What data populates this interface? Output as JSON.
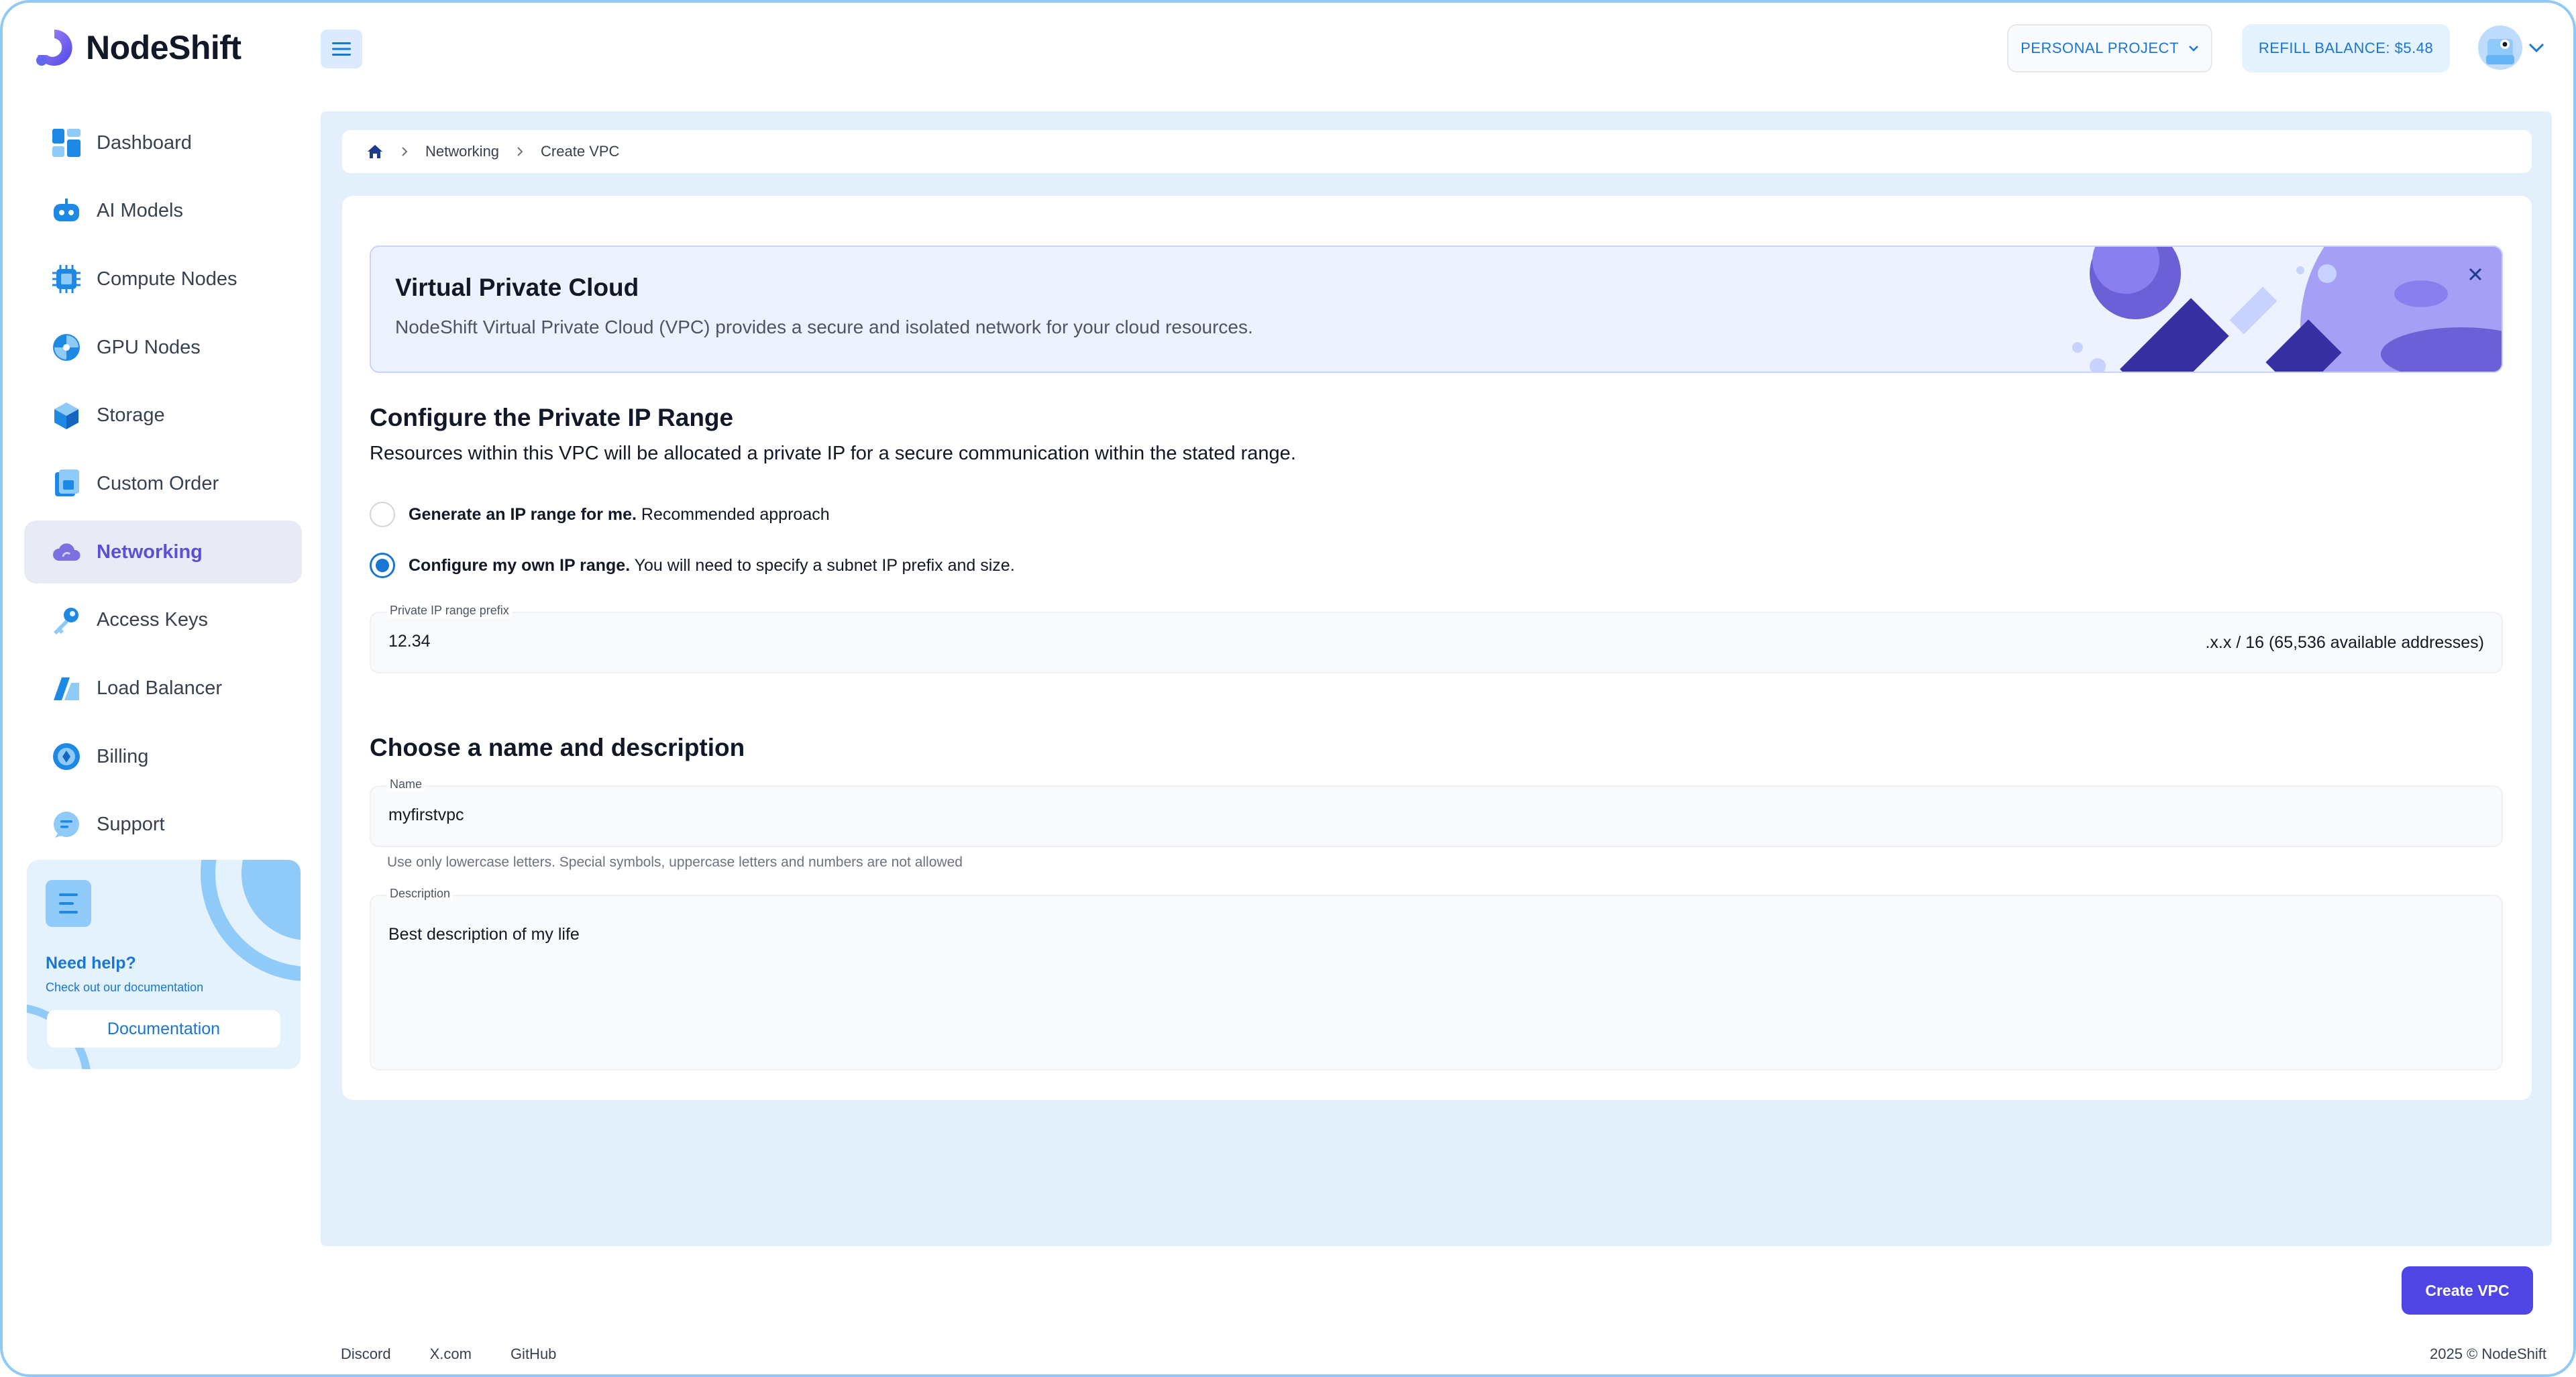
{
  "brand": {
    "name": "NodeShift"
  },
  "header": {
    "project_label": "PERSONAL PROJECT",
    "refill_label": "REFILL BALANCE: $5.48"
  },
  "sidebar": {
    "items": [
      {
        "label": "Dashboard",
        "icon": "dashboard-icon"
      },
      {
        "label": "AI Models",
        "icon": "robot-icon"
      },
      {
        "label": "Compute Nodes",
        "icon": "chip-icon"
      },
      {
        "label": "GPU Nodes",
        "icon": "gpu-icon"
      },
      {
        "label": "Storage",
        "icon": "cube-icon"
      },
      {
        "label": "Custom Order",
        "icon": "order-icon"
      },
      {
        "label": "Networking",
        "icon": "cloud-icon"
      },
      {
        "label": "Access Keys",
        "icon": "key-icon"
      },
      {
        "label": "Load Balancer",
        "icon": "balancer-icon"
      },
      {
        "label": "Billing",
        "icon": "billing-icon"
      },
      {
        "label": "Support",
        "icon": "chat-icon"
      }
    ],
    "active_index": 6,
    "help": {
      "title": "Need help?",
      "subtitle": "Check out our documentation",
      "button": "Documentation"
    }
  },
  "breadcrumb": {
    "items": [
      "Networking",
      "Create VPC"
    ]
  },
  "banner": {
    "title": "Virtual Private Cloud",
    "description": "NodeShift Virtual Private Cloud (VPC) provides a secure and isolated network for your cloud resources."
  },
  "ip_section": {
    "title": "Configure the Private IP Range",
    "description": "Resources within this VPC will be allocated a private IP for a secure communication within the stated range.",
    "option_auto": {
      "bold": "Generate an IP range for me.",
      "rest": " Recommended approach",
      "checked": false
    },
    "option_custom": {
      "bold": "Configure my own IP range.",
      "rest": " You will need to specify a subnet IP prefix and size.",
      "checked": true
    },
    "prefix_field": {
      "label": "Private IP range prefix",
      "value": "12.34",
      "suffix": ".x.x / 16 (65,536 available addresses)"
    }
  },
  "name_section": {
    "title": "Choose a name and description",
    "name_field": {
      "label": "Name",
      "value": "myfirstvpc"
    },
    "name_hint": "Use only lowercase letters. Special symbols, uppercase letters and numbers are not allowed",
    "description_field": {
      "label": "Description",
      "value": "Best description of my life"
    }
  },
  "actions": {
    "create_label": "Create VPC"
  },
  "footer": {
    "links": [
      "Discord",
      "X.com",
      "GitHub"
    ],
    "copyright": "2025 © NodeShift"
  },
  "colors": {
    "accent": "#4f46e5",
    "link": "#1976d2",
    "main_bg": "#e3f0fc"
  }
}
